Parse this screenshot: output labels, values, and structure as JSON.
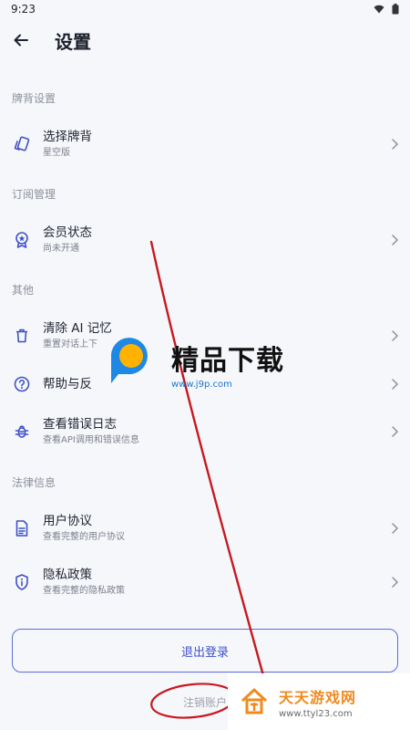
{
  "status_bar": {
    "time": "9:23"
  },
  "app_bar": {
    "title": "设置"
  },
  "sections": {
    "cardback": {
      "label": "牌背设置",
      "items": [
        {
          "title": "选择牌背",
          "subtitle": "星空版"
        }
      ]
    },
    "subscription": {
      "label": "订阅管理",
      "items": [
        {
          "title": "会员状态",
          "subtitle": "尚未开通"
        }
      ]
    },
    "other": {
      "label": "其他",
      "items": [
        {
          "title": "清除 AI 记忆",
          "subtitle": "重置对话上下"
        },
        {
          "title": "帮助与反",
          "subtitle": ""
        },
        {
          "title": "查看错误日志",
          "subtitle": "查看API调用和错误信息"
        }
      ]
    },
    "legal": {
      "label": "法律信息",
      "items": [
        {
          "title": "用户协议",
          "subtitle": "查看完整的用户协议"
        },
        {
          "title": "隐私政策",
          "subtitle": "查看完整的隐私政策"
        }
      ]
    }
  },
  "actions": {
    "logout_label": "退出登录",
    "delete_account_label": "注销账户"
  },
  "watermarks": {
    "center_title": "精品下载",
    "center_url": "www.j9p.com",
    "corner_title": "天天游戏网",
    "corner_url": "www.ttyl23.com"
  },
  "colors": {
    "accent": "#3f51c8",
    "annotation": "#c8171e",
    "background": "#f6f7fb"
  }
}
